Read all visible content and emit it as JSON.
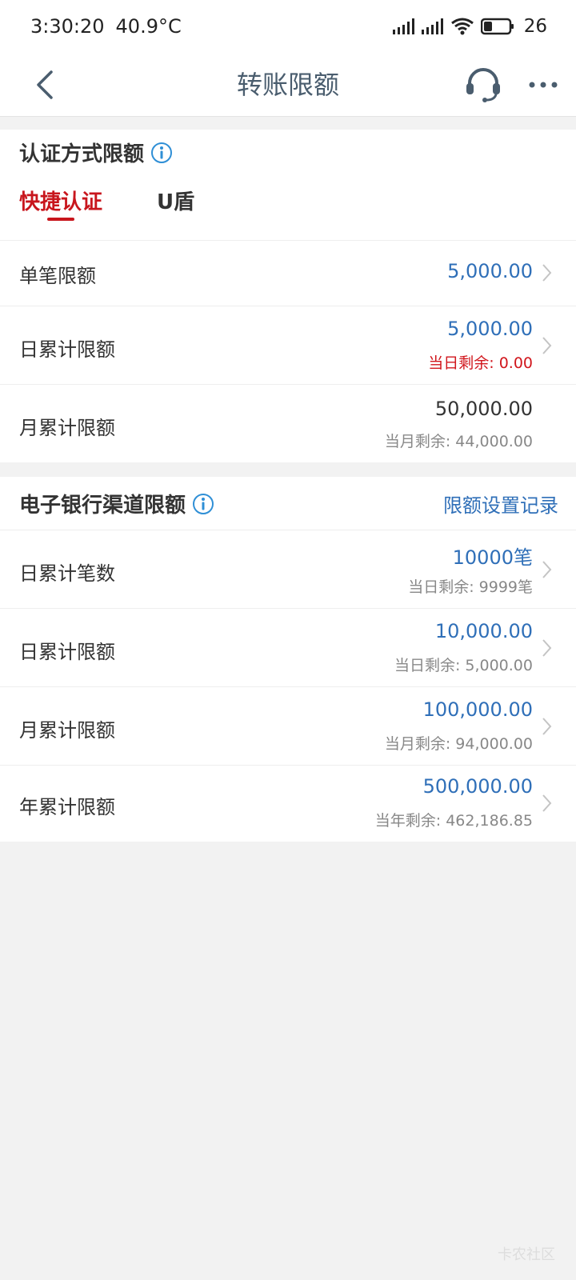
{
  "status_bar": {
    "time": "3:30:20",
    "temperature": "40.9°C",
    "battery_level": "26"
  },
  "nav": {
    "title": "转账限额"
  },
  "auth_section": {
    "title": "认证方式限额",
    "tabs": [
      {
        "label": "快捷认证",
        "active": true
      },
      {
        "label": "U盾",
        "active": false
      }
    ],
    "rows": [
      {
        "label": "单笔限额",
        "value": "5,000.00"
      },
      {
        "label": "日累计限额",
        "value": "5,000.00",
        "sub": "当日剩余: 0.00"
      },
      {
        "label": "月累计限额",
        "value": "50,000.00",
        "sub": "当月剩余: 44,000.00"
      }
    ]
  },
  "channel_section": {
    "title": "电子银行渠道限额",
    "record_link": "限额设置记录",
    "rows": [
      {
        "label": "日累计笔数",
        "value": "10000笔",
        "sub": "当日剩余: 9999笔"
      },
      {
        "label": "日累计限额",
        "value": "10,000.00",
        "sub": "当日剩余: 5,000.00"
      },
      {
        "label": "月累计限额",
        "value": "100,000.00",
        "sub": "当月剩余: 94,000.00"
      },
      {
        "label": "年累计限额",
        "value": "500,000.00",
        "sub": "当年剩余: 462,186.85"
      }
    ]
  },
  "watermark": "卡农社区",
  "colors": {
    "accent_red": "#c8161d",
    "link_blue": "#2f6fb8",
    "background": "#f2f2f2"
  },
  "icons": [
    "signal-icon",
    "wifi-icon",
    "battery-icon",
    "back-icon",
    "headset-icon",
    "more-icon",
    "info-icon",
    "chevron-right-icon"
  ]
}
